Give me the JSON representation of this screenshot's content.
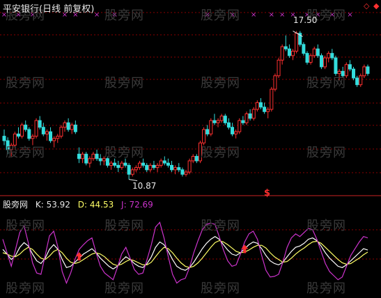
{
  "header": {
    "title": "平安银行(日线 前复权)",
    "sub_label": "股旁网",
    "k_label": "K: 53.92",
    "d_label": "D: 44.53",
    "j_label": "J: 72.69"
  },
  "watermark": "股旁网",
  "window_controls": {
    "diamond": "◇",
    "dot": "◆"
  },
  "annotations": {
    "high_label": "17.50",
    "low_label": "10.87",
    "signal_mark": "$",
    "signal_marker": "×"
  },
  "colors": {
    "up": "#ff3030",
    "down": "#33dddd",
    "grid": "#8b0000",
    "k_line": "#ffffff",
    "d_line": "#ffff66",
    "j_line": "#cc33cc",
    "marker": "#cc33cc",
    "arrow": "#ff3030"
  },
  "chart_data": [
    {
      "type": "candlestick",
      "title": "平安银行(日线 前复权)",
      "ylim": [
        10.3,
        18.2
      ],
      "candles": [
        [
          12.8,
          13.1,
          12.4,
          12.6
        ],
        [
          12.6,
          12.75,
          12.0,
          12.2
        ],
        [
          12.2,
          12.5,
          11.9,
          12.4
        ],
        [
          12.4,
          13.0,
          12.3,
          12.9
        ],
        [
          12.9,
          13.2,
          12.7,
          12.8
        ],
        [
          12.8,
          13.4,
          12.7,
          13.3
        ],
        [
          13.3,
          13.5,
          13.0,
          13.1
        ],
        [
          13.1,
          13.2,
          12.6,
          12.7
        ],
        [
          12.7,
          12.9,
          12.4,
          12.8
        ],
        [
          12.8,
          13.6,
          12.7,
          13.5
        ],
        [
          13.5,
          13.7,
          13.1,
          13.2
        ],
        [
          13.2,
          13.4,
          12.8,
          12.9
        ],
        [
          12.9,
          13.1,
          12.6,
          13.0
        ],
        [
          13.0,
          13.2,
          12.5,
          12.6
        ],
        [
          12.6,
          12.8,
          12.3,
          12.7
        ],
        [
          12.7,
          12.9,
          12.5,
          12.8
        ],
        [
          12.8,
          13.3,
          12.7,
          13.2
        ],
        [
          13.2,
          13.5,
          13.0,
          13.4
        ],
        [
          13.4,
          13.6,
          13.0,
          13.1
        ],
        [
          13.1,
          13.4,
          12.9,
          13.3
        ],
        [
          13.3,
          13.5,
          12.9,
          13.0
        ],
        [
          12.0,
          12.3,
          11.6,
          11.8
        ],
        [
          11.8,
          12.1,
          11.6,
          12.0
        ],
        [
          12.0,
          12.1,
          11.5,
          11.6
        ],
        [
          11.6,
          11.9,
          11.4,
          11.8
        ],
        [
          11.8,
          12.1,
          11.7,
          12.0
        ],
        [
          12.0,
          12.2,
          11.7,
          11.8
        ],
        [
          11.8,
          12.0,
          11.5,
          11.7
        ],
        [
          11.7,
          11.9,
          11.5,
          11.8
        ],
        [
          11.8,
          11.9,
          11.4,
          11.5
        ],
        [
          11.5,
          11.7,
          11.3,
          11.6
        ],
        [
          11.6,
          11.8,
          11.4,
          11.5
        ],
        [
          11.5,
          11.7,
          11.2,
          11.4
        ],
        [
          11.4,
          11.7,
          11.3,
          11.6
        ],
        [
          11.6,
          11.8,
          11.4,
          11.5
        ],
        [
          11.5,
          11.6,
          10.87,
          11.1
        ],
        [
          11.1,
          11.4,
          11.0,
          11.3
        ],
        [
          11.3,
          11.5,
          11.2,
          11.4
        ],
        [
          11.4,
          11.7,
          11.3,
          11.6
        ],
        [
          11.6,
          11.8,
          11.4,
          11.5
        ],
        [
          11.5,
          11.6,
          11.2,
          11.3
        ],
        [
          11.3,
          11.6,
          11.2,
          11.5
        ],
        [
          11.5,
          11.7,
          11.3,
          11.4
        ],
        [
          11.4,
          11.6,
          11.2,
          11.5
        ],
        [
          11.5,
          11.8,
          11.4,
          11.7
        ],
        [
          11.7,
          11.9,
          11.5,
          11.6
        ],
        [
          11.6,
          11.8,
          11.4,
          11.5
        ],
        [
          11.5,
          11.7,
          11.2,
          11.3
        ],
        [
          11.3,
          11.5,
          11.1,
          11.4
        ],
        [
          11.4,
          11.6,
          11.2,
          11.3
        ],
        [
          11.3,
          11.4,
          11.0,
          11.1
        ],
        [
          11.1,
          11.3,
          11.0,
          11.2
        ],
        [
          11.2,
          11.8,
          11.1,
          11.7
        ],
        [
          11.7,
          12.0,
          11.6,
          11.9
        ],
        [
          11.9,
          12.0,
          11.6,
          11.7
        ],
        [
          11.7,
          12.6,
          11.6,
          12.5
        ],
        [
          12.5,
          13.2,
          12.4,
          13.1
        ],
        [
          13.1,
          13.3,
          12.8,
          12.9
        ],
        [
          12.9,
          13.6,
          12.8,
          13.5
        ],
        [
          13.5,
          13.8,
          13.3,
          13.4
        ],
        [
          13.4,
          13.6,
          13.2,
          13.5
        ],
        [
          13.5,
          13.8,
          13.4,
          13.7
        ],
        [
          13.7,
          13.8,
          13.3,
          13.4
        ],
        [
          13.4,
          13.6,
          13.1,
          13.2
        ],
        [
          13.2,
          13.4,
          12.8,
          12.9
        ],
        [
          12.9,
          13.1,
          12.7,
          13.0
        ],
        [
          13.0,
          13.6,
          12.9,
          13.5
        ],
        [
          13.5,
          13.7,
          13.3,
          13.4
        ],
        [
          13.4,
          13.9,
          13.3,
          13.8
        ],
        [
          13.8,
          14.0,
          13.5,
          13.6
        ],
        [
          13.6,
          14.1,
          13.5,
          14.0
        ],
        [
          14.0,
          14.4,
          13.9,
          14.3
        ],
        [
          14.3,
          14.5,
          14.0,
          14.1
        ],
        [
          14.1,
          14.3,
          13.8,
          13.9
        ],
        [
          13.9,
          14.1,
          13.6,
          14.0
        ],
        [
          14.0,
          15.0,
          13.9,
          14.9
        ],
        [
          14.9,
          15.6,
          14.8,
          15.5
        ],
        [
          15.5,
          16.3,
          15.4,
          16.2
        ],
        [
          16.2,
          16.9,
          16.0,
          16.8
        ],
        [
          16.8,
          17.3,
          16.6,
          16.7
        ],
        [
          16.7,
          16.9,
          16.3,
          16.4
        ],
        [
          16.4,
          16.7,
          16.2,
          16.6
        ],
        [
          16.6,
          17.5,
          16.5,
          17.4
        ],
        [
          17.4,
          17.5,
          16.8,
          16.9
        ],
        [
          16.9,
          17.0,
          16.4,
          16.5
        ],
        [
          16.5,
          16.6,
          16.0,
          16.1
        ],
        [
          16.1,
          16.5,
          16.0,
          16.4
        ],
        [
          16.4,
          16.8,
          16.3,
          16.7
        ],
        [
          16.7,
          16.9,
          16.3,
          16.4
        ],
        [
          16.4,
          16.5,
          15.8,
          15.9
        ],
        [
          15.9,
          16.4,
          15.8,
          16.3
        ],
        [
          16.3,
          16.6,
          16.1,
          16.5
        ],
        [
          16.5,
          16.7,
          16.2,
          16.3
        ],
        [
          16.3,
          16.4,
          15.5,
          15.6
        ],
        [
          15.6,
          15.8,
          15.3,
          15.7
        ],
        [
          15.7,
          15.9,
          15.4,
          15.5
        ],
        [
          15.5,
          16.1,
          15.4,
          16.0
        ],
        [
          16.0,
          16.2,
          15.7,
          15.8
        ],
        [
          15.8,
          15.9,
          15.3,
          15.4
        ],
        [
          15.4,
          15.5,
          15.0,
          15.1
        ],
        [
          15.1,
          15.6,
          15.0,
          15.5
        ],
        [
          15.5,
          16.0,
          15.4,
          15.9
        ],
        [
          15.9,
          16.0,
          15.5,
          15.6
        ]
      ],
      "annotations": [
        {
          "text": "17.50",
          "x_index": 81,
          "value": 17.5
        },
        {
          "text": "10.87",
          "x_index": 35,
          "value": 10.87
        }
      ],
      "sell_markers": [
        0,
        4,
        8,
        17,
        20,
        26,
        31,
        57,
        64,
        70,
        75,
        78,
        81,
        85,
        88,
        92,
        97
      ],
      "signal_index": 75
    },
    {
      "type": "line",
      "title": "股旁网",
      "ylim": [
        -15,
        115
      ],
      "series": [
        {
          "name": "K",
          "values": [
            55,
            48,
            40,
            46,
            58,
            65,
            60,
            48,
            38,
            34,
            42,
            55,
            62,
            55,
            40,
            28,
            30,
            36,
            42,
            48,
            52,
            56,
            50,
            42,
            36,
            30,
            26,
            30,
            38,
            44,
            40,
            34,
            30,
            28,
            34,
            44,
            58,
            66,
            62,
            52,
            40,
            30,
            26,
            24,
            28,
            36,
            46,
            56,
            64,
            70,
            74,
            70,
            62,
            54,
            48,
            46,
            50,
            56,
            62,
            66,
            64,
            56,
            46,
            38,
            34,
            32,
            36,
            44,
            52,
            58,
            60,
            64,
            70,
            72,
            68,
            60,
            50,
            42,
            36,
            30,
            28,
            32,
            38,
            44,
            50,
            56,
            54
          ]
        },
        {
          "name": "D",
          "values": [
            50,
            48,
            45,
            44,
            48,
            54,
            58,
            55,
            48,
            42,
            40,
            45,
            52,
            55,
            50,
            42,
            36,
            34,
            36,
            40,
            44,
            48,
            50,
            48,
            44,
            38,
            33,
            31,
            33,
            37,
            40,
            38,
            35,
            32,
            32,
            36,
            44,
            52,
            58,
            56,
            50,
            42,
            35,
            30,
            28,
            30,
            35,
            42,
            50,
            58,
            65,
            68,
            66,
            62,
            57,
            52,
            50,
            51,
            54,
            58,
            61,
            61,
            57,
            50,
            44,
            40,
            36,
            37,
            42,
            48,
            53,
            57,
            62,
            66,
            67,
            64,
            58,
            52,
            46,
            40,
            35,
            33,
            34,
            38,
            42,
            47,
            51
          ]
        },
        {
          "name": "J",
          "values": [
            70,
            50,
            30,
            55,
            80,
            90,
            65,
            35,
            20,
            18,
            46,
            75,
            82,
            58,
            22,
            5,
            20,
            40,
            55,
            62,
            68,
            72,
            50,
            30,
            20,
            15,
            10,
            28,
            48,
            58,
            42,
            25,
            18,
            20,
            40,
            62,
            88,
            95,
            72,
            44,
            18,
            5,
            10,
            12,
            28,
            50,
            68,
            84,
            92,
            94,
            92,
            74,
            54,
            38,
            30,
            32,
            48,
            66,
            78,
            82,
            70,
            46,
            24,
            14,
            15,
            18,
            36,
            58,
            72,
            78,
            74,
            80,
            86,
            84,
            70,
            52,
            34,
            22,
            16,
            10,
            14,
            30,
            46,
            56,
            66,
            74,
            72
          ]
        }
      ],
      "buy_signals": [
        18,
        57
      ]
    }
  ]
}
